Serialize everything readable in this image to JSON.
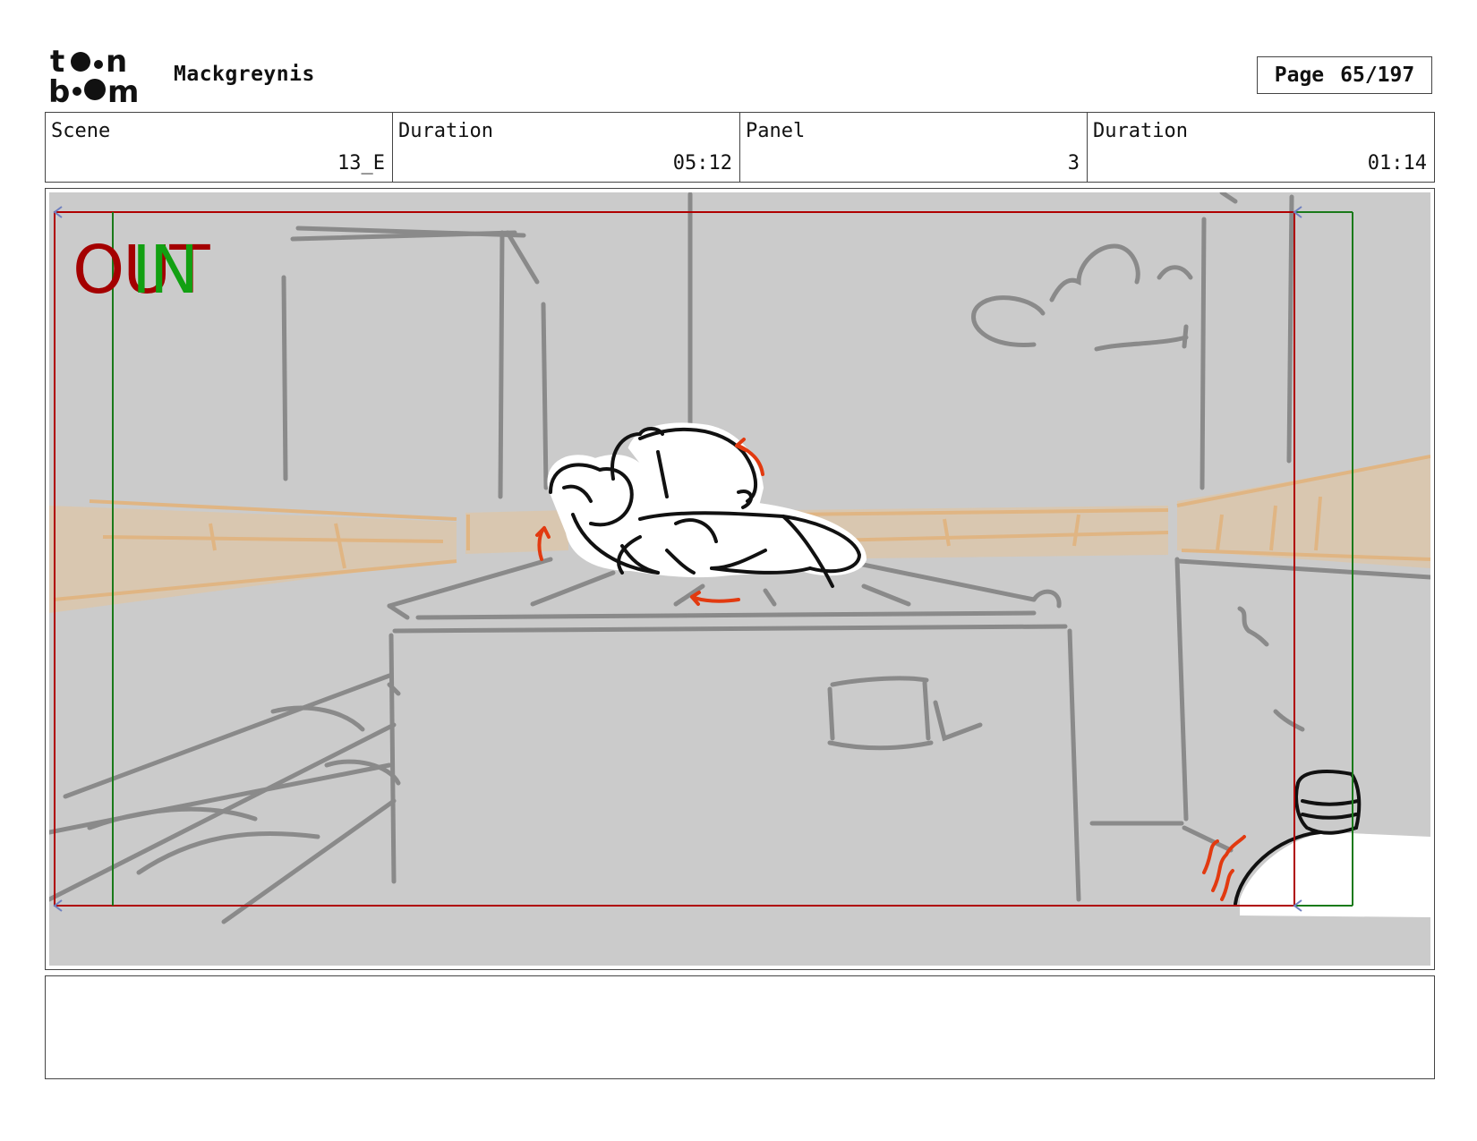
{
  "header": {
    "logo_text_top": "toon",
    "logo_text_bottom": "boom",
    "project_title": "Mackgreynis",
    "page_label": "Page",
    "page_value": "65/197"
  },
  "info": [
    {
      "label": "Scene",
      "value": "13_E"
    },
    {
      "label": "Duration",
      "value": "05:12"
    },
    {
      "label": "Panel",
      "value": "3"
    },
    {
      "label": "Duration",
      "value": "01:14"
    }
  ],
  "panel": {
    "overlay_out": "OUT",
    "overlay_in": "IN",
    "colors": {
      "background": "#cbcbcb",
      "sketch": "#8a8a8a",
      "railing": "#e6c49a",
      "frame_out": "#b00000",
      "frame_in": "#1a7a1a",
      "motion_arrow": "#e23a10"
    }
  },
  "notes": {
    "text": ""
  }
}
